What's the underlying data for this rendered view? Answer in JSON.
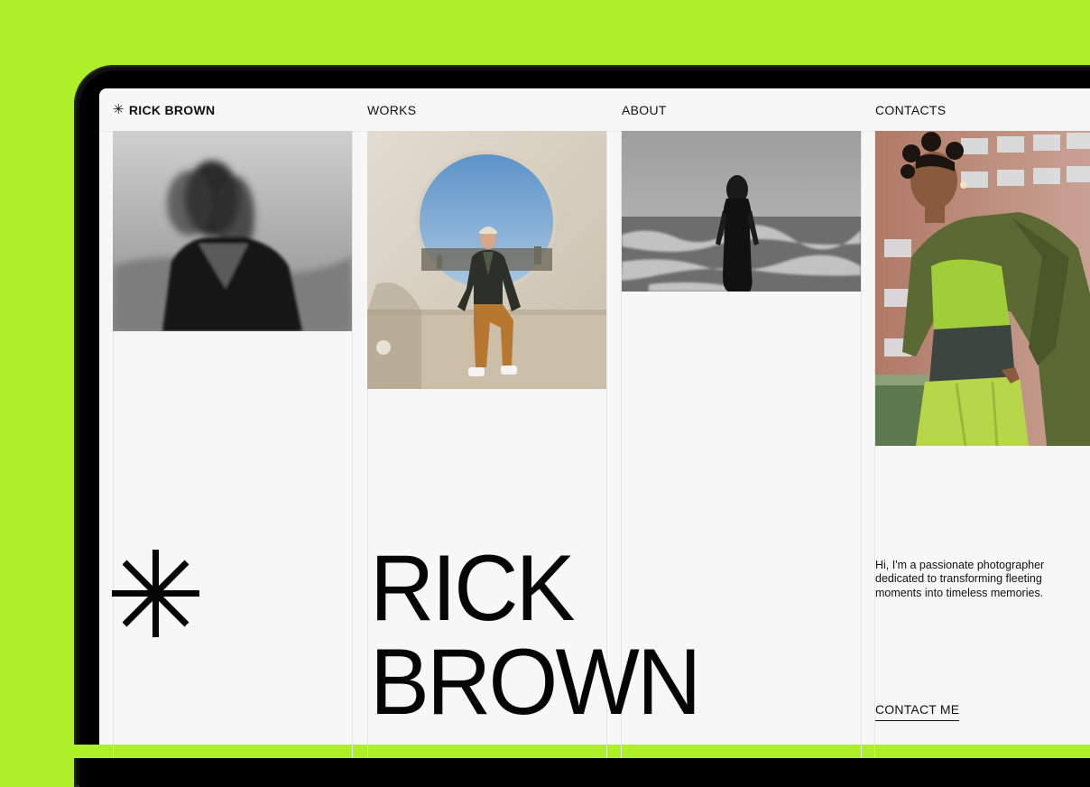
{
  "colors": {
    "background": "#aef028",
    "screen": "#f7f7f7",
    "text": "#111111"
  },
  "nav": {
    "logo_icon": "asterisk-icon",
    "logo_text": "RICK BROWN",
    "works": "WORKS",
    "about": "ABOUT",
    "contacts": "CONTACTS"
  },
  "hero": {
    "name_line1": "RICK",
    "name_line2": "BROWN",
    "star_icon": "asterisk-icon"
  },
  "intro_text": "Hi, I'm a passionate photographer dedicated to transforming fleeting moments into timeless memories.",
  "contact_button": "CONTACT ME",
  "photos": [
    "blurred-woman-bw-photo",
    "man-round-window-photo",
    "woman-sea-bw-photo",
    "woman-green-outfit-photo"
  ]
}
